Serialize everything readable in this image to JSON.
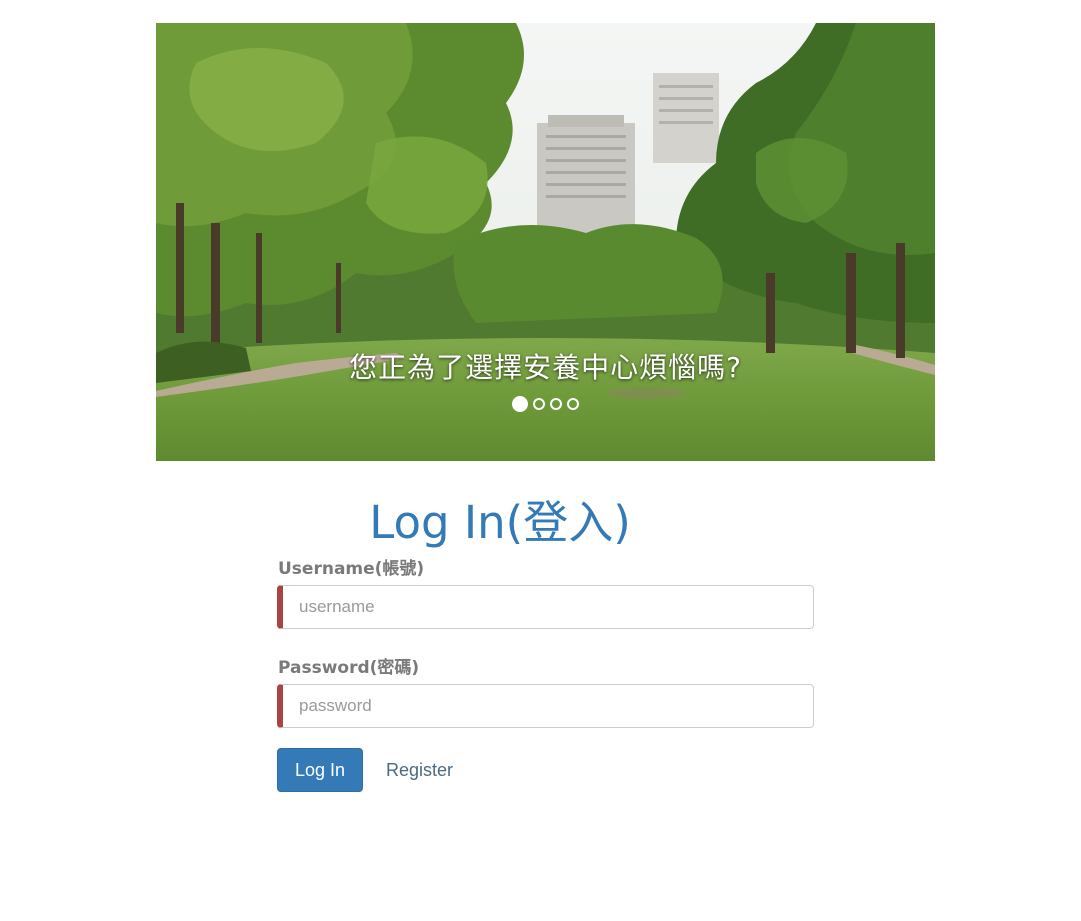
{
  "carousel": {
    "caption": "您正為了選擇安養中心煩惱嗎?",
    "slide_count": 4,
    "active_slide": 1,
    "image": "park-with-trees-and-lawn"
  },
  "login": {
    "title": "Log In(登入)",
    "username_label": "Username(帳號)",
    "username_placeholder": "username",
    "password_label": "Password(密碼)",
    "password_placeholder": "password",
    "login_button": "Log In",
    "register_link": "Register"
  },
  "colors": {
    "primary": "#337ab7",
    "error_border": "#a94442",
    "label": "#7a7a7a"
  }
}
